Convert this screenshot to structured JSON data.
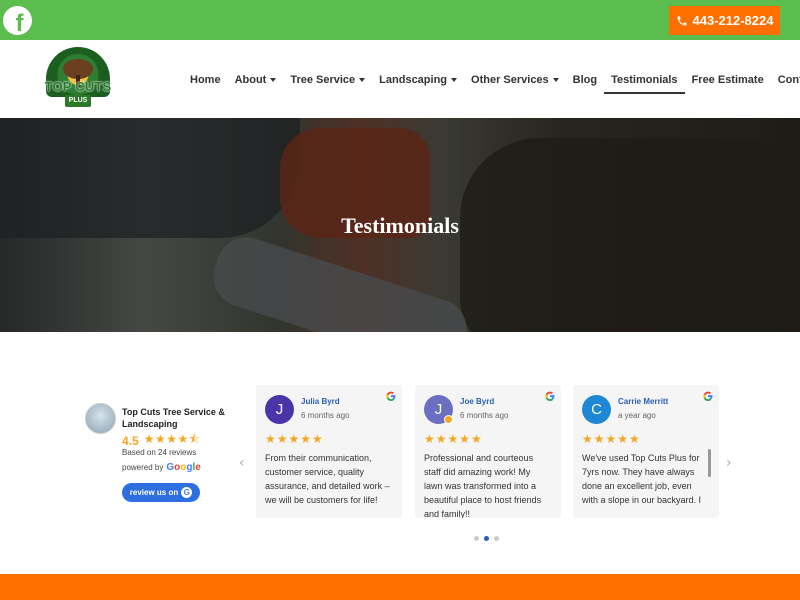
{
  "topbar": {
    "phone": "443-212-8224",
    "facebook_icon": "facebook-icon",
    "phone_icon": "phone-icon",
    "colors": {
      "bar": "#5cbd4f",
      "button": "#ff6f00"
    }
  },
  "logo": {
    "text": "TOP CUTS",
    "sub": "PLUS"
  },
  "nav": {
    "items": [
      {
        "label": "Home",
        "dropdown": false
      },
      {
        "label": "About",
        "dropdown": true
      },
      {
        "label": "Tree Service",
        "dropdown": true
      },
      {
        "label": "Landscaping",
        "dropdown": true
      },
      {
        "label": "Other Services",
        "dropdown": true
      },
      {
        "label": "Blog",
        "dropdown": false
      },
      {
        "label": "Testimonials",
        "dropdown": false,
        "active": true
      },
      {
        "label": "Free Estimate",
        "dropdown": false
      },
      {
        "label": "Contact",
        "dropdown": false
      }
    ]
  },
  "hero": {
    "title": "Testimonials"
  },
  "summary": {
    "business_name": "Top Cuts Tree Service & Landscaping",
    "rating": "4.5",
    "stars": "★★★★⯪",
    "based_on": "Based on 24 reviews",
    "powered_by": "powered by",
    "google": "Google",
    "review_button": "review us on"
  },
  "reviews": [
    {
      "initial": "J",
      "name": "Julia Byrd",
      "time": "6 months ago",
      "stars": "★★★★★",
      "text": "From their communication, customer service, quality assurance, and detailed work – we will be customers for life!",
      "avatar_color": "#4a35a8"
    },
    {
      "initial": "J",
      "name": "Joe Byrd",
      "time": "6 months ago",
      "stars": "★★★★★",
      "text": "Professional and courteous staff did amazing work! My lawn was transformed into a beautiful place to host friends and family!!",
      "avatar_color": "#6a6fc2"
    },
    {
      "initial": "C",
      "name": "Carrie Merritt",
      "time": "a year ago",
      "stars": "★★★★★",
      "text": "We've used Top Cuts Plus for 7yrs now.  They have always done an excellent job, even with a slope in our backyard.  I",
      "avatar_color": "#1e88d4"
    }
  ],
  "carousel": {
    "prev": "‹",
    "next": "›",
    "pages": 3,
    "current": 2
  }
}
